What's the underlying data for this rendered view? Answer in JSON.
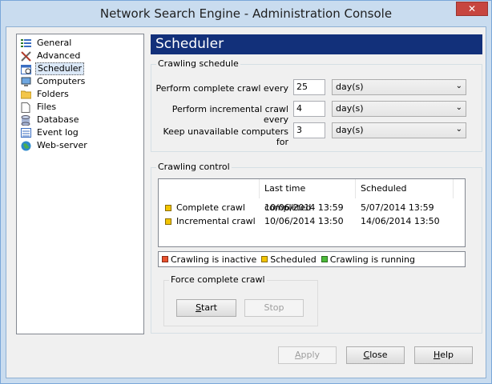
{
  "window": {
    "title": "Network Search Engine - Administration Console",
    "close_glyph": "✕"
  },
  "nav": {
    "items": [
      {
        "label": "General",
        "icon": "list-icon"
      },
      {
        "label": "Advanced",
        "icon": "tools-icon"
      },
      {
        "label": "Scheduler",
        "icon": "calendar-icon",
        "selected": true
      },
      {
        "label": "Computers",
        "icon": "computer-icon"
      },
      {
        "label": "Folders",
        "icon": "folder-icon"
      },
      {
        "label": "Files",
        "icon": "file-icon"
      },
      {
        "label": "Database",
        "icon": "database-icon"
      },
      {
        "label": "Event log",
        "icon": "eventlog-icon"
      },
      {
        "label": "Web-server",
        "icon": "globe-icon"
      }
    ]
  },
  "panel": {
    "title": "Scheduler"
  },
  "crawling_schedule": {
    "title": "Crawling schedule",
    "rows": [
      {
        "label": "Perform complete crawl every",
        "value": "25",
        "unit": "day(s)"
      },
      {
        "label": "Perform incremental crawl every",
        "value": "4",
        "unit": "day(s)"
      },
      {
        "label": "Keep unavailable computers for",
        "value": "3",
        "unit": "day(s)"
      }
    ]
  },
  "crawling_control": {
    "title": "Crawling control",
    "columns": [
      "",
      "Last time completed",
      "Scheduled"
    ],
    "rows": [
      {
        "name": "Complete crawl",
        "last": "10/06/2014 13:59",
        "scheduled": "5/07/2014 13:59"
      },
      {
        "name": "Incremental crawl",
        "last": "10/06/2014 13:50",
        "scheduled": "14/06/2014 13:50"
      }
    ],
    "legend": [
      {
        "label": "Crawling is inactive",
        "color": "#e8522e"
      },
      {
        "label": "Scheduled",
        "color": "#f2c400"
      },
      {
        "label": "Crawling is running",
        "color": "#4cbb3a"
      }
    ],
    "status_color": "#f2c400"
  },
  "force": {
    "title": "Force complete crawl",
    "start": {
      "mnemonic": "S",
      "rest": "tart"
    },
    "stop": {
      "mnemonic": "",
      "rest": "Stop"
    }
  },
  "buttons": {
    "apply": {
      "mnemonic": "A",
      "rest": "pply"
    },
    "close": {
      "mnemonic": "C",
      "rest": "lose"
    },
    "help": {
      "mnemonic": "H",
      "rest": "elp"
    }
  }
}
